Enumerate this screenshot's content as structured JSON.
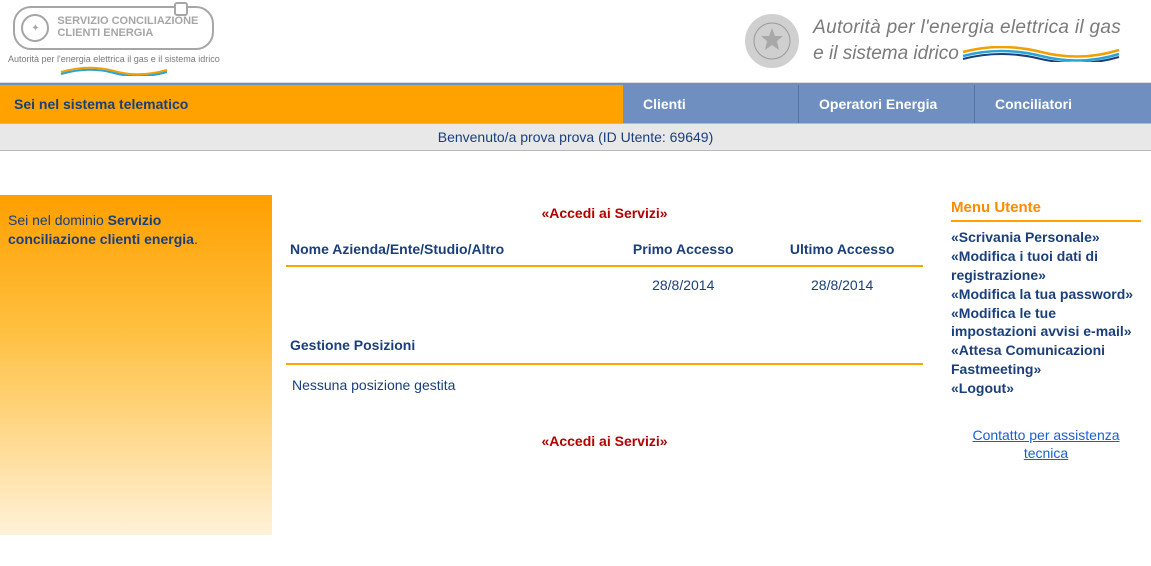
{
  "header": {
    "left_logo_line1": "SERVIZIO CONCILIAZIONE",
    "left_logo_line2": "CLIENTI ENERGIA",
    "left_logo_sub": "Autorità per l'energia elettrica il gas\ne il sistema idrico",
    "right_line1": "Autorità per l'energia elettrica il gas",
    "right_line2": "e il sistema idrico"
  },
  "nav": {
    "title": "Sei nel sistema telematico",
    "tabs": [
      "Clienti",
      "Operatori Energia",
      "Conciliatori"
    ]
  },
  "welcome": "Benvenuto/a prova prova (ID Utente: 69649)",
  "side": {
    "prefix": "Sei nel dominio ",
    "domain1": "Servizio",
    "domain2": "conciliazione clienti energia",
    "suffix": "."
  },
  "accedi_label": "«Accedi ai Servizi»",
  "table": {
    "headers": [
      "Nome Azienda/Ente/Studio/Altro",
      "Primo Accesso",
      "Ultimo Accesso"
    ],
    "row": {
      "name": "",
      "primo": "28/8/2014",
      "ultimo": "28/8/2014"
    }
  },
  "positions": {
    "title": "Gestione Posizioni",
    "empty": "Nessuna posizione gestita"
  },
  "menu": {
    "title": "Menu Utente",
    "items": [
      "«Scrivania Personale»",
      "«Modifica i tuoi dati di registrazione»",
      "«Modifica la tua password»",
      "«Modifica le tue impostazioni avvisi e-mail»",
      "«Attesa Comunicazioni Fastmeeting»",
      "«Logout»"
    ]
  },
  "assist": "Contatto per assistenza tecnica"
}
